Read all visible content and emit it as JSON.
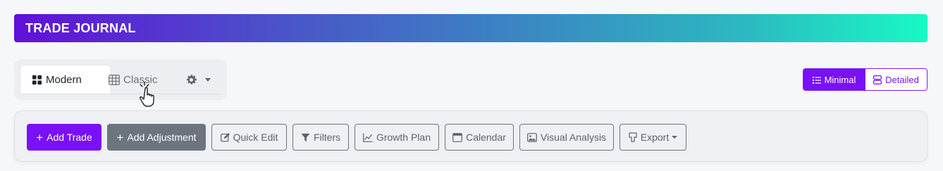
{
  "app": {
    "title": "TRADE JOURNAL"
  },
  "view_tabs": {
    "modern_label": "Modern",
    "classic_label": "Classic",
    "active": "Modern"
  },
  "display_mode": {
    "minimal_label": "Minimal",
    "detailed_label": "Detailed",
    "active": "Minimal"
  },
  "toolbar": {
    "add_trade_label": "Add Trade",
    "add_adjustment_label": "Add Adjustment",
    "quick_edit_label": "Quick Edit",
    "filters_label": "Filters",
    "growth_plan_label": "Growth Plan",
    "calendar_label": "Calendar",
    "visual_analysis_label": "Visual Analysis",
    "export_label": "Export"
  },
  "icons": {
    "modern": "grid-icon",
    "classic": "table-icon",
    "settings": "gear-icon",
    "minimal": "list-icon",
    "detailed": "stacked-rows-icon",
    "quick_edit": "edit-icon",
    "filters": "funnel-icon",
    "growth_plan": "line-chart-icon",
    "calendar": "calendar-icon",
    "visual_analysis": "image-icon",
    "export": "download-icon",
    "cursor": "hand-pointer-icon"
  },
  "colors": {
    "accent": "#7a10f5",
    "secondary": "#6c757d",
    "gradient_start": "#6110d8",
    "gradient_end": "#18f9c4"
  }
}
